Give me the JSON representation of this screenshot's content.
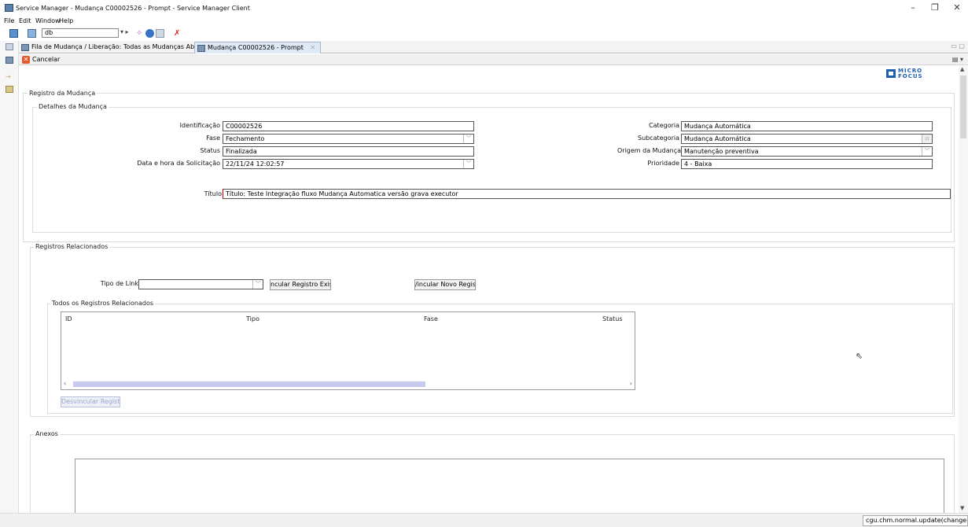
{
  "window": {
    "title": "Service Manager - Mudança C00002526 - Prompt - Service Manager Client"
  },
  "menu": [
    "File",
    "Edit",
    "Window",
    "Help"
  ],
  "toolbar": {
    "db_value": "db"
  },
  "tabs": [
    {
      "label": "Fila de Mudança / Liberação: Todas as Mudanças Abertas"
    },
    {
      "label": "Mudança C00002526 - Prompt"
    }
  ],
  "actionbar": {
    "cancel_label": "Cancelar"
  },
  "logo": {
    "text_top": "MICRO",
    "text_bottom": "FOCUS"
  },
  "form": {
    "section_title": "Registro da Mudança",
    "details_title": "Detalhes da Mudança",
    "left_fields": [
      {
        "label": "Identificação",
        "value": "C00002526",
        "dropdown": false
      },
      {
        "label": "Fase",
        "value": "Fechamento",
        "dropdown": true
      },
      {
        "label": "Status",
        "value": "Finalizada",
        "dropdown": false
      },
      {
        "label": "Data e hora da Solicitação",
        "value": "22/11/24 12:02:57",
        "dropdown": true
      }
    ],
    "right_fields": [
      {
        "label": "Categoria",
        "value": "Mudança Automática",
        "dropdown": false
      },
      {
        "label": "Subcategoria",
        "value": "Mudança Automática",
        "dropdown": true
      },
      {
        "label": "Origem da Mudança",
        "value": "Manutenção preventiva",
        "dropdown": true
      },
      {
        "label": "Prioridade",
        "value": "4 - Baixa",
        "dropdown": false
      }
    ],
    "titulo_label": "Título",
    "titulo_value": "Título: Teste Integração fluxo Mudança Automatica versão grava executor"
  },
  "related": {
    "section_title": "Registros Relacionados",
    "link_type_label": "Tipo de Link",
    "link_type_value": "",
    "btn_link_existing": "ncular Registro Exister",
    "btn_link_new": "/incular Novo Registro",
    "all_title": "Todos os Registros Relacionados",
    "columns": [
      "ID",
      "Tipo",
      "Fase",
      "Status"
    ],
    "rows": [],
    "btn_unlink": "Desvincular Registro"
  },
  "attachments": {
    "section_title": "Anexos"
  },
  "statusbar": {
    "text": "cgu.chm.normal.update(change.view)"
  }
}
